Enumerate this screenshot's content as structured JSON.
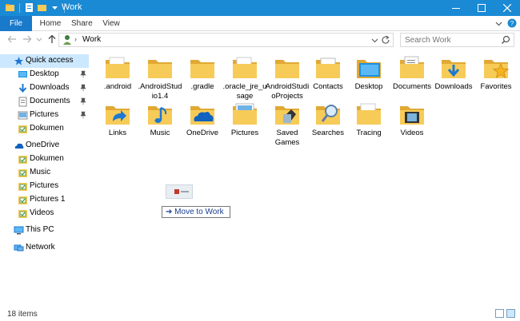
{
  "window": {
    "title": "Work"
  },
  "ribbon": {
    "tabs": [
      "File",
      "Home",
      "Share",
      "View"
    ]
  },
  "address": {
    "path": "Work",
    "search_placeholder": "Search Work"
  },
  "nav": {
    "items": [
      {
        "label": "Quick access",
        "icon": "star-icon",
        "pinned": false
      },
      {
        "label": "Desktop",
        "icon": "desktop-icon",
        "pinned": true
      },
      {
        "label": "Downloads",
        "icon": "download-icon",
        "pinned": true
      },
      {
        "label": "Documents",
        "icon": "documents-icon",
        "pinned": true
      },
      {
        "label": "Pictures",
        "icon": "pictures-icon",
        "pinned": true
      },
      {
        "label": "Dokumenti",
        "icon": "folder-icon",
        "pinned": false
      },
      {
        "label": "OneDrive",
        "icon": "cloud-icon",
        "pinned": false
      },
      {
        "label": "Dokumenti",
        "icon": "folder-icon",
        "pinned": false
      },
      {
        "label": "Music",
        "icon": "folder-icon",
        "pinned": false
      },
      {
        "label": "Pictures",
        "icon": "folder-icon",
        "pinned": false
      },
      {
        "label": "Pictures 1",
        "icon": "folder-icon",
        "pinned": false
      },
      {
        "label": "Videos",
        "icon": "folder-icon",
        "pinned": false
      },
      {
        "label": "This PC",
        "icon": "computer-icon",
        "pinned": false
      },
      {
        "label": "Network",
        "icon": "network-icon",
        "pinned": false
      }
    ]
  },
  "files": [
    {
      "label": ".android",
      "kind": "folder-doc"
    },
    {
      "label": ".AndroidStudio1.4",
      "kind": "folder"
    },
    {
      "label": ".gradle",
      "kind": "folder"
    },
    {
      "label": ".oracle_jre_usage",
      "kind": "folder-doc"
    },
    {
      "label": "AndroidStudioProjects",
      "kind": "folder"
    },
    {
      "label": "Contacts",
      "kind": "contacts"
    },
    {
      "label": "Desktop",
      "kind": "desktop"
    },
    {
      "label": "Documents",
      "kind": "documents"
    },
    {
      "label": "Downloads",
      "kind": "downloads"
    },
    {
      "label": "Favorites",
      "kind": "favorites"
    },
    {
      "label": "Links",
      "kind": "links"
    },
    {
      "label": "Music",
      "kind": "music"
    },
    {
      "label": "OneDrive",
      "kind": "onedrive"
    },
    {
      "label": "Pictures",
      "kind": "pictures"
    },
    {
      "label": "Saved Games",
      "kind": "savedgames"
    },
    {
      "label": "Searches",
      "kind": "searches"
    },
    {
      "label": "Tracing",
      "kind": "folder-doc"
    },
    {
      "label": "Videos",
      "kind": "videos"
    }
  ],
  "drag": {
    "tooltip": "Move to Work"
  },
  "status": {
    "count_text": "18 items"
  },
  "colors": {
    "accent": "#1a8ad4",
    "file_tab": "#1979ca",
    "selection": "#cce8ff",
    "folder": "#f7cb58",
    "folder_dark": "#e1a934"
  }
}
